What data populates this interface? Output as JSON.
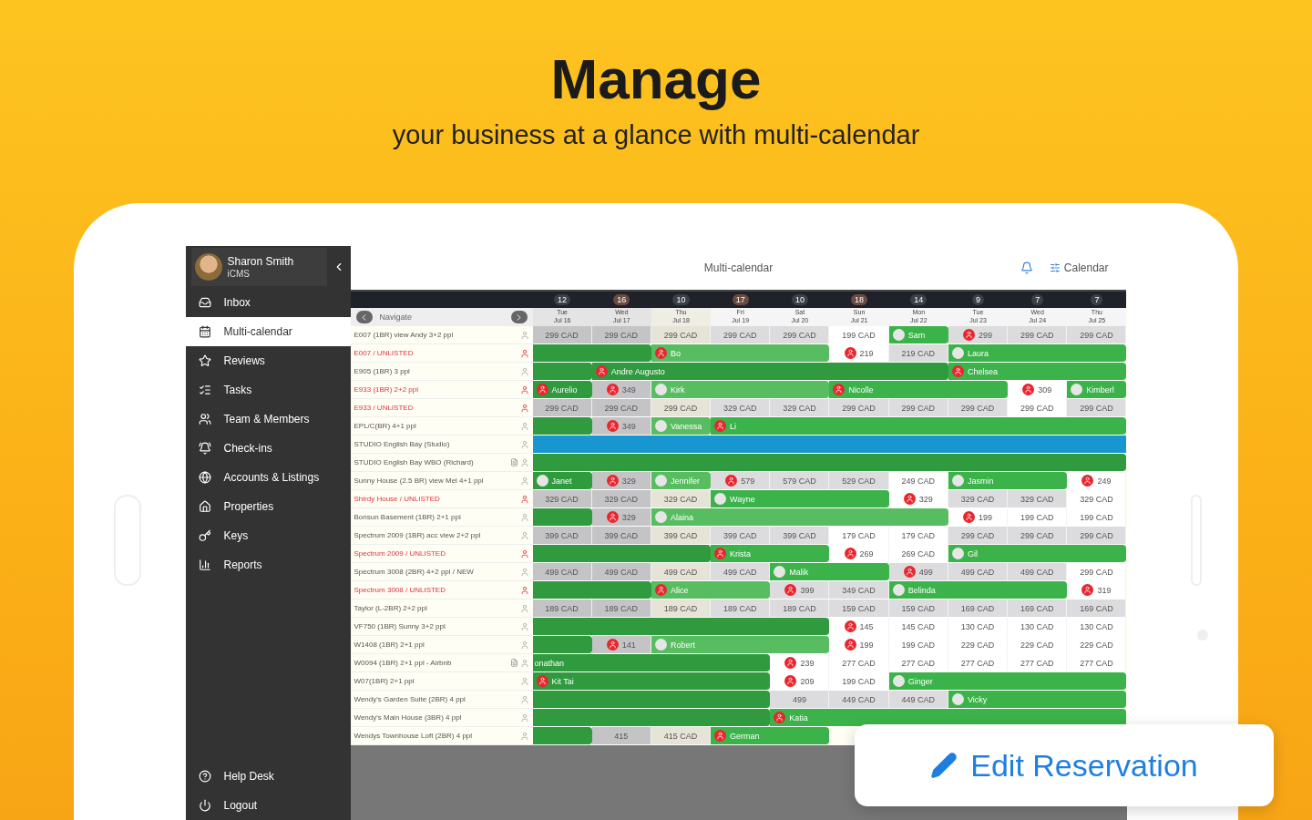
{
  "headline": {
    "title": "Manage",
    "subtitle": "your business at a glance with multi-calendar"
  },
  "sidebar": {
    "user": {
      "name": "Sharon Smith",
      "company": "iCMS"
    },
    "items": [
      {
        "label": "Inbox",
        "selected": false
      },
      {
        "label": "Multi-calendar",
        "selected": true
      },
      {
        "label": "Reviews",
        "selected": false
      },
      {
        "label": "Tasks",
        "selected": false
      },
      {
        "label": "Team & Members",
        "selected": false
      },
      {
        "label": "Check-ins",
        "selected": false
      },
      {
        "label": "Accounts & Listings",
        "selected": false
      },
      {
        "label": "Properties",
        "selected": false
      },
      {
        "label": "Keys",
        "selected": false
      },
      {
        "label": "Reports",
        "selected": false
      }
    ],
    "footer": [
      {
        "label": "Help Desk"
      },
      {
        "label": "Logout"
      }
    ]
  },
  "topbar": {
    "title": "Multi-calendar",
    "link": "Calendar"
  },
  "navigate": "Navigate",
  "days": [
    {
      "count": "12",
      "weekday": "Tue",
      "date": "Jul 16",
      "highlight": false,
      "past": true,
      "today": false
    },
    {
      "count": "16",
      "weekday": "Wed",
      "date": "Jul 17",
      "highlight": true,
      "past": true,
      "today": false
    },
    {
      "count": "10",
      "weekday": "Thu",
      "date": "Jul 18",
      "highlight": false,
      "past": false,
      "today": true
    },
    {
      "count": "17",
      "weekday": "Fri",
      "date": "Jul 19",
      "highlight": true,
      "past": false,
      "today": false
    },
    {
      "count": "10",
      "weekday": "Sat",
      "date": "Jul 20",
      "highlight": false,
      "past": false,
      "today": false
    },
    {
      "count": "18",
      "weekday": "Sun",
      "date": "Jul 21",
      "highlight": true,
      "past": false,
      "today": false
    },
    {
      "count": "14",
      "weekday": "Mon",
      "date": "Jul 22",
      "highlight": false,
      "past": false,
      "today": false
    },
    {
      "count": "9",
      "weekday": "Tue",
      "date": "Jul 23",
      "highlight": false,
      "past": false,
      "today": false
    },
    {
      "count": "7",
      "weekday": "Wed",
      "date": "Jul 24",
      "highlight": false,
      "past": false,
      "today": false
    },
    {
      "count": "7",
      "weekday": "Thu",
      "date": "Jul 25",
      "highlight": false,
      "past": false,
      "today": false
    }
  ],
  "listings": [
    {
      "name": "E007 (1BR) view Andy 3+2 ppl",
      "unlisted": false,
      "note": false,
      "cells": [
        {
          "kind": "price",
          "text": "299 CAD",
          "alert": false
        },
        {
          "kind": "price",
          "text": "299 CAD",
          "alert": false
        },
        {
          "kind": "price",
          "text": "299 CAD",
          "alert": false
        },
        {
          "kind": "price",
          "text": "299 CAD",
          "alert": false
        },
        {
          "kind": "price",
          "text": "299 CAD",
          "alert": false
        },
        {
          "kind": "open",
          "text": "199 CAD",
          "alert": false
        },
        {
          "kind": "checkin",
          "text": "Sam",
          "alert": false
        },
        {
          "kind": "price",
          "text": "299",
          "alert": true
        },
        {
          "kind": "price",
          "text": "299 CAD",
          "alert": false
        },
        {
          "kind": "price",
          "text": "299 CAD",
          "alert": false
        }
      ]
    },
    {
      "name": "E007 / UNLISTED",
      "unlisted": true,
      "note": false,
      "cells": [
        {
          "kind": "stay"
        },
        {
          "kind": "stay"
        },
        {
          "kind": "checkin",
          "text": "Bo",
          "alert": true
        },
        {
          "kind": "stay"
        },
        {
          "kind": "stay"
        },
        {
          "kind": "open",
          "text": "219",
          "alert": true
        },
        {
          "kind": "price",
          "text": "219 CAD",
          "alert": false
        },
        {
          "kind": "checkin",
          "text": "Laura",
          "alert": false
        },
        {
          "kind": "stay"
        },
        {
          "kind": "stay"
        }
      ]
    },
    {
      "name": "E905 (1BR) 3 ppl",
      "unlisted": false,
      "note": false,
      "cells": [
        {
          "kind": "stay"
        },
        {
          "kind": "checkin",
          "text": "Andre Augusto",
          "alert": true
        },
        {
          "kind": "stay"
        },
        {
          "kind": "stay"
        },
        {
          "kind": "stay"
        },
        {
          "kind": "stay"
        },
        {
          "kind": "stay"
        },
        {
          "kind": "checkin",
          "text": "Chelsea",
          "alert": true
        },
        {
          "kind": "stay"
        },
        {
          "kind": "stay"
        }
      ]
    },
    {
      "name": "E933 (1BR) 2+2 ppl",
      "unlisted": true,
      "note": false,
      "cells": [
        {
          "kind": "checkin",
          "text": "Aurelio",
          "alert": true
        },
        {
          "kind": "price",
          "text": "349",
          "alert": true
        },
        {
          "kind": "checkin",
          "text": "Kirk",
          "alert": false
        },
        {
          "kind": "stay"
        },
        {
          "kind": "stay"
        },
        {
          "kind": "checkin",
          "text": "Nicolle",
          "alert": true
        },
        {
          "kind": "stay"
        },
        {
          "kind": "stay"
        },
        {
          "kind": "open",
          "text": "309",
          "alert": true
        },
        {
          "kind": "checkin",
          "text": "Kimberl",
          "alert": false
        }
      ]
    },
    {
      "name": "E933 / UNLISTED",
      "unlisted": true,
      "note": false,
      "cells": [
        {
          "kind": "price",
          "text": "299 CAD",
          "alert": false
        },
        {
          "kind": "price",
          "text": "299 CAD",
          "alert": false
        },
        {
          "kind": "price",
          "text": "299 CAD",
          "alert": false
        },
        {
          "kind": "price",
          "text": "329 CAD",
          "alert": false
        },
        {
          "kind": "price",
          "text": "329 CAD",
          "alert": false
        },
        {
          "kind": "price",
          "text": "299 CAD",
          "alert": false
        },
        {
          "kind": "price",
          "text": "299 CAD",
          "alert": false
        },
        {
          "kind": "price",
          "text": "299 CAD",
          "alert": false
        },
        {
          "kind": "open",
          "text": "299 CAD",
          "alert": false
        },
        {
          "kind": "price",
          "text": "299 CAD",
          "alert": false
        }
      ]
    },
    {
      "name": "EPL/C(BR) 4+1 ppl",
      "unlisted": false,
      "note": false,
      "cells": [
        {
          "kind": "stay"
        },
        {
          "kind": "price",
          "text": "349",
          "alert": true
        },
        {
          "kind": "checkin",
          "text": "Vanessa",
          "alert": false
        },
        {
          "kind": "checkin",
          "text": "Li",
          "alert": true
        },
        {
          "kind": "stay"
        },
        {
          "kind": "stay"
        },
        {
          "kind": "stay"
        },
        {
          "kind": "stay"
        },
        {
          "kind": "stay"
        },
        {
          "kind": "stay"
        }
      ]
    },
    {
      "name": "STUDIO English Bay (Studio)",
      "unlisted": false,
      "note": false,
      "cells": [
        {
          "kind": "blocked"
        },
        {
          "kind": "blocked"
        },
        {
          "kind": "blocked"
        },
        {
          "kind": "blocked"
        },
        {
          "kind": "blocked"
        },
        {
          "kind": "blocked"
        },
        {
          "kind": "blocked"
        },
        {
          "kind": "blocked"
        },
        {
          "kind": "blocked"
        },
        {
          "kind": "blocked"
        }
      ]
    },
    {
      "name": "STUDIO English Bay WBO (Richard)",
      "unlisted": false,
      "note": true,
      "cells": [
        {
          "kind": "stay"
        },
        {
          "kind": "stay"
        },
        {
          "kind": "stay"
        },
        {
          "kind": "stay"
        },
        {
          "kind": "stay"
        },
        {
          "kind": "stay"
        },
        {
          "kind": "stay"
        },
        {
          "kind": "stay"
        },
        {
          "kind": "stay"
        },
        {
          "kind": "stay"
        }
      ]
    },
    {
      "name": "Sunny House (2.5 BR) view Mel 4+1 ppl",
      "unlisted": false,
      "note": false,
      "cells": [
        {
          "kind": "checkin",
          "text": "Janet",
          "alert": false
        },
        {
          "kind": "price",
          "text": "329",
          "alert": true
        },
        {
          "kind": "checkin",
          "text": "Jennifer",
          "alert": false
        },
        {
          "kind": "price",
          "text": "579",
          "alert": true
        },
        {
          "kind": "price",
          "text": "579 CAD",
          "alert": false
        },
        {
          "kind": "price",
          "text": "529 CAD",
          "alert": false
        },
        {
          "kind": "open",
          "text": "249 CAD",
          "alert": false
        },
        {
          "kind": "checkin",
          "text": "Jasmin",
          "alert": false
        },
        {
          "kind": "stay"
        },
        {
          "kind": "open",
          "text": "249",
          "alert": true
        }
      ]
    },
    {
      "name": "Shirdy House / UNLISTED",
      "unlisted": true,
      "note": false,
      "cells": [
        {
          "kind": "price",
          "text": "329 CAD",
          "alert": false
        },
        {
          "kind": "price",
          "text": "329 CAD",
          "alert": false
        },
        {
          "kind": "price",
          "text": "329 CAD",
          "alert": false
        },
        {
          "kind": "checkin",
          "text": "Wayne",
          "alert": false
        },
        {
          "kind": "stay"
        },
        {
          "kind": "stay"
        },
        {
          "kind": "open",
          "text": "329",
          "alert": true
        },
        {
          "kind": "price",
          "text": "329 CAD",
          "alert": false
        },
        {
          "kind": "price",
          "text": "329 CAD",
          "alert": false
        },
        {
          "kind": "open",
          "text": "329 CAD",
          "alert": false
        }
      ]
    },
    {
      "name": "Bonsun Basement (1BR) 2+1 ppl",
      "unlisted": false,
      "note": false,
      "cells": [
        {
          "kind": "stay"
        },
        {
          "kind": "price",
          "text": "329",
          "alert": true
        },
        {
          "kind": "checkin",
          "text": "Alaina",
          "alert": false
        },
        {
          "kind": "stay"
        },
        {
          "kind": "stay"
        },
        {
          "kind": "stay"
        },
        {
          "kind": "stay"
        },
        {
          "kind": "open",
          "text": "199",
          "alert": true
        },
        {
          "kind": "open",
          "text": "199 CAD",
          "alert": false
        },
        {
          "kind": "open",
          "text": "199 CAD",
          "alert": false
        }
      ]
    },
    {
      "name": "Spectrum 2009 (1BR) acc view 2+2 ppl",
      "unlisted": false,
      "note": false,
      "cells": [
        {
          "kind": "price",
          "text": "399 CAD",
          "alert": false
        },
        {
          "kind": "price",
          "text": "399 CAD",
          "alert": false
        },
        {
          "kind": "price",
          "text": "399 CAD",
          "alert": false
        },
        {
          "kind": "price",
          "text": "399 CAD",
          "alert": false
        },
        {
          "kind": "price",
          "text": "399 CAD",
          "alert": false
        },
        {
          "kind": "open",
          "text": "179 CAD",
          "alert": false
        },
        {
          "kind": "open",
          "text": "179 CAD",
          "alert": false
        },
        {
          "kind": "price",
          "text": "299 CAD",
          "alert": false
        },
        {
          "kind": "price",
          "text": "299 CAD",
          "alert": false
        },
        {
          "kind": "price",
          "text": "299 CAD",
          "alert": false
        }
      ]
    },
    {
      "name": "Spectrum 2009 / UNLISTED",
      "unlisted": true,
      "note": false,
      "cells": [
        {
          "kind": "stay"
        },
        {
          "kind": "stay"
        },
        {
          "kind": "stay"
        },
        {
          "kind": "checkin",
          "text": "Krista",
          "alert": true
        },
        {
          "kind": "stay"
        },
        {
          "kind": "open",
          "text": "269",
          "alert": true
        },
        {
          "kind": "open",
          "text": "269 CAD",
          "alert": false
        },
        {
          "kind": "checkin",
          "text": "Gil",
          "alert": false
        },
        {
          "kind": "stay"
        },
        {
          "kind": "stay"
        }
      ]
    },
    {
      "name": "Spectrum 3008 (2BR) 4+2 ppl / NEW",
      "unlisted": false,
      "note": false,
      "cells": [
        {
          "kind": "price",
          "text": "499 CAD",
          "alert": false
        },
        {
          "kind": "price",
          "text": "499 CAD",
          "alert": false
        },
        {
          "kind": "price",
          "text": "499 CAD",
          "alert": false
        },
        {
          "kind": "price",
          "text": "499 CAD",
          "alert": false
        },
        {
          "kind": "checkin",
          "text": "Malik",
          "alert": false
        },
        {
          "kind": "stay"
        },
        {
          "kind": "price",
          "text": "499",
          "alert": true
        },
        {
          "kind": "price",
          "text": "499 CAD",
          "alert": false
        },
        {
          "kind": "price",
          "text": "499 CAD",
          "alert": false
        },
        {
          "kind": "open",
          "text": "299 CAD",
          "alert": false
        }
      ]
    },
    {
      "name": "Spectrum 3008 / UNLISTED",
      "unlisted": true,
      "note": false,
      "cells": [
        {
          "kind": "stay"
        },
        {
          "kind": "stay"
        },
        {
          "kind": "checkin",
          "text": "Alice",
          "alert": true
        },
        {
          "kind": "stay"
        },
        {
          "kind": "price",
          "text": "399",
          "alert": true
        },
        {
          "kind": "price",
          "text": "349 CAD",
          "alert": false
        },
        {
          "kind": "checkin",
          "text": "Belinda",
          "alert": false
        },
        {
          "kind": "stay"
        },
        {
          "kind": "stay"
        },
        {
          "kind": "open",
          "text": "319",
          "alert": true
        }
      ]
    },
    {
      "name": "Taylor (L-2BR) 2+2 ppl",
      "unlisted": false,
      "note": false,
      "cells": [
        {
          "kind": "price",
          "text": "189 CAD",
          "alert": false
        },
        {
          "kind": "price",
          "text": "189 CAD",
          "alert": false
        },
        {
          "kind": "price",
          "text": "189 CAD",
          "alert": false
        },
        {
          "kind": "price",
          "text": "189 CAD",
          "alert": false
        },
        {
          "kind": "price",
          "text": "189 CAD",
          "alert": false
        },
        {
          "kind": "price",
          "text": "159 CAD",
          "alert": false
        },
        {
          "kind": "price",
          "text": "159 CAD",
          "alert": false
        },
        {
          "kind": "price",
          "text": "169 CAD",
          "alert": false
        },
        {
          "kind": "price",
          "text": "169 CAD",
          "alert": false
        },
        {
          "kind": "price",
          "text": "169 CAD",
          "alert": false
        }
      ]
    },
    {
      "name": "VF750 (1BR) Sunny 3+2 ppl",
      "unlisted": false,
      "note": false,
      "cells": [
        {
          "kind": "stay"
        },
        {
          "kind": "stay"
        },
        {
          "kind": "stay"
        },
        {
          "kind": "stay"
        },
        {
          "kind": "stay"
        },
        {
          "kind": "open",
          "text": "145",
          "alert": true
        },
        {
          "kind": "open",
          "text": "145 CAD",
          "alert": false
        },
        {
          "kind": "open",
          "text": "130 CAD",
          "alert": false
        },
        {
          "kind": "open",
          "text": "130 CAD",
          "alert": false
        },
        {
          "kind": "open",
          "text": "130 CAD",
          "alert": false
        }
      ]
    },
    {
      "name": "W1408 (1BR) 2+1 ppl",
      "unlisted": false,
      "note": false,
      "cells": [
        {
          "kind": "stay"
        },
        {
          "kind": "price",
          "text": "141",
          "alert": true
        },
        {
          "kind": "checkin",
          "text": "Robert",
          "alert": false
        },
        {
          "kind": "stay"
        },
        {
          "kind": "stay"
        },
        {
          "kind": "open",
          "text": "199",
          "alert": true
        },
        {
          "kind": "open",
          "text": "199 CAD",
          "alert": false
        },
        {
          "kind": "open",
          "text": "229 CAD",
          "alert": false
        },
        {
          "kind": "open",
          "text": "229 CAD",
          "alert": false
        },
        {
          "kind": "open",
          "text": "229 CAD",
          "alert": false
        }
      ]
    },
    {
      "name": "W0094 (1BR) 2+1 ppl - Airbnb",
      "unlisted": false,
      "note": true,
      "cells": [
        {
          "kind": "stay",
          "text": "onathan"
        },
        {
          "kind": "stay"
        },
        {
          "kind": "stay"
        },
        {
          "kind": "stay"
        },
        {
          "kind": "open",
          "text": "239",
          "alert": true
        },
        {
          "kind": "open",
          "text": "277 CAD",
          "alert": false
        },
        {
          "kind": "open",
          "text": "277 CAD",
          "alert": false
        },
        {
          "kind": "open",
          "text": "277 CAD",
          "alert": false
        },
        {
          "kind": "open",
          "text": "277 CAD",
          "alert": false
        },
        {
          "kind": "open",
          "text": "277 CAD",
          "alert": false
        }
      ]
    },
    {
      "name": "W07(1BR) 2+1 ppl",
      "unlisted": false,
      "note": false,
      "cells": [
        {
          "kind": "checkin",
          "text": "Kit Tai",
          "alert": true
        },
        {
          "kind": "stay"
        },
        {
          "kind": "stay"
        },
        {
          "kind": "stay"
        },
        {
          "kind": "open",
          "text": "209",
          "alert": true
        },
        {
          "kind": "open",
          "text": "199 CAD",
          "alert": false
        },
        {
          "kind": "checkin",
          "text": "Ginger",
          "alert": false
        },
        {
          "kind": "stay"
        },
        {
          "kind": "stay"
        },
        {
          "kind": "stay"
        }
      ]
    },
    {
      "name": "Wendy's Garden Suite (2BR) 4 ppl",
      "unlisted": false,
      "note": false,
      "cells": [
        {
          "kind": "stay"
        },
        {
          "kind": "stay"
        },
        {
          "kind": "stay"
        },
        {
          "kind": "stay"
        },
        {
          "kind": "price",
          "text": "499",
          "alert": false
        },
        {
          "kind": "price",
          "text": "449 CAD",
          "alert": false
        },
        {
          "kind": "price",
          "text": "449 CAD",
          "alert": false
        },
        {
          "kind": "checkin",
          "text": "Vicky",
          "alert": false
        },
        {
          "kind": "stay"
        },
        {
          "kind": "stay"
        }
      ]
    },
    {
      "name": "Wendy's Main House (3BR) 4 ppl",
      "unlisted": false,
      "note": false,
      "cells": [
        {
          "kind": "stay"
        },
        {
          "kind": "stay"
        },
        {
          "kind": "stay"
        },
        {
          "kind": "stay"
        },
        {
          "kind": "checkin",
          "text": "Katia",
          "alert": true
        },
        {
          "kind": "stay"
        },
        {
          "kind": "stay"
        },
        {
          "kind": "stay"
        },
        {
          "kind": "stay"
        },
        {
          "kind": "stay"
        }
      ]
    },
    {
      "name": "Wendys Townhouse Loft (2BR) 4 ppl",
      "unlisted": false,
      "note": false,
      "cells": [
        {
          "kind": "stay"
        },
        {
          "kind": "price",
          "text": "415",
          "alert": false
        },
        {
          "kind": "price",
          "text": "415 CAD",
          "alert": false
        },
        {
          "kind": "checkin",
          "text": "German",
          "alert": true
        },
        {
          "kind": "stay"
        }
      ]
    }
  ],
  "action": {
    "label": "Edit Reservation"
  }
}
